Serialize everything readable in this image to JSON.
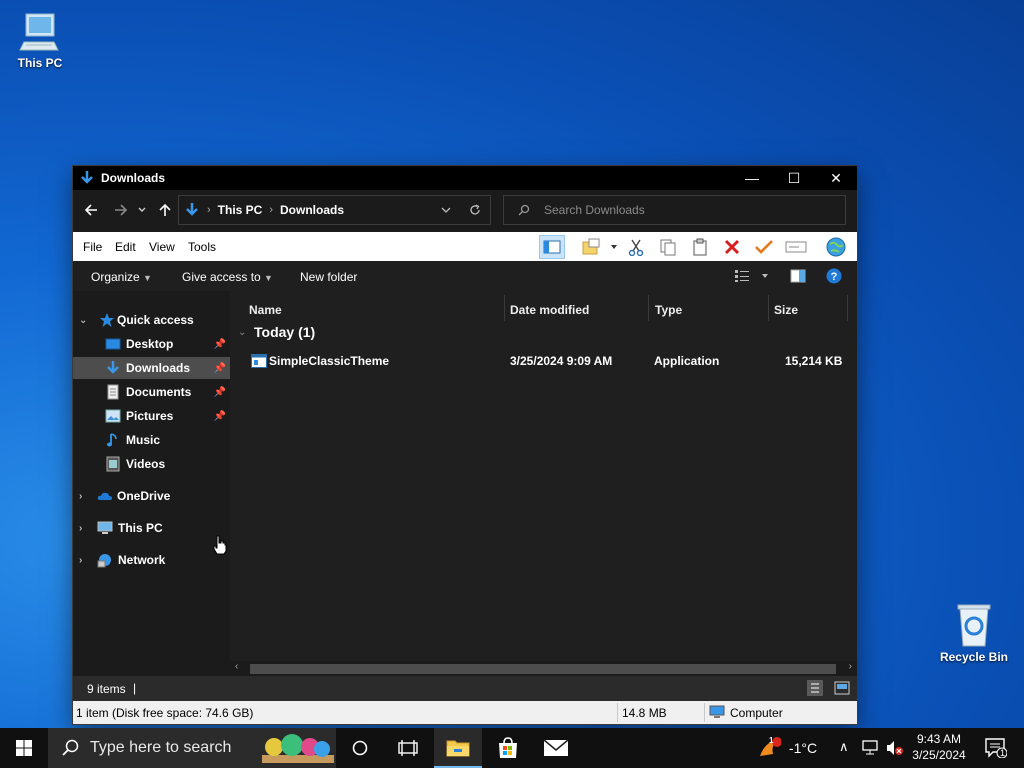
{
  "desktop": {
    "this_pc_label": "This PC",
    "recycle_bin_label": "Recycle Bin"
  },
  "window": {
    "title": "Downloads",
    "minimize": "—",
    "maximize": "☐",
    "close": "✕"
  },
  "address": {
    "crumbs": [
      "This PC",
      "Downloads"
    ],
    "search_placeholder": "Search Downloads"
  },
  "menubar": {
    "file": "File",
    "edit": "Edit",
    "view": "View",
    "tools": "Tools"
  },
  "commands": {
    "organize": "Organize",
    "give_access": "Give access to",
    "new_folder": "New folder"
  },
  "nav": {
    "quick_access": "Quick access",
    "items": [
      {
        "label": "Desktop",
        "pinned": true
      },
      {
        "label": "Downloads",
        "pinned": true,
        "selected": true
      },
      {
        "label": "Documents",
        "pinned": true
      },
      {
        "label": "Pictures",
        "pinned": true
      },
      {
        "label": "Music",
        "pinned": false
      },
      {
        "label": "Videos",
        "pinned": false
      }
    ],
    "onedrive": "OneDrive",
    "this_pc": "This PC",
    "network": "Network"
  },
  "columns": {
    "name": "Name",
    "date": "Date modified",
    "type": "Type",
    "size": "Size"
  },
  "group": {
    "label": "Today (1)"
  },
  "files": [
    {
      "name": "SimpleClassicTheme",
      "date": "3/25/2024 9:09 AM",
      "type": "Application",
      "size": "15,214 KB"
    }
  ],
  "status": {
    "items": "9 items",
    "divider": "|"
  },
  "details": {
    "selection": "1 item (Disk free space: 74.6 GB)",
    "size": "14.8 MB",
    "location": "Computer"
  },
  "taskbar": {
    "search_placeholder": "Type here to search",
    "weather": "-1°C",
    "weather_badge": "1",
    "time": "9:43 AM",
    "date": "3/25/2024",
    "notification_count": "1"
  },
  "colors": {
    "accent": "#0078d7",
    "selected": "#4d4d4d",
    "window_bg": "#1f1f1f"
  }
}
